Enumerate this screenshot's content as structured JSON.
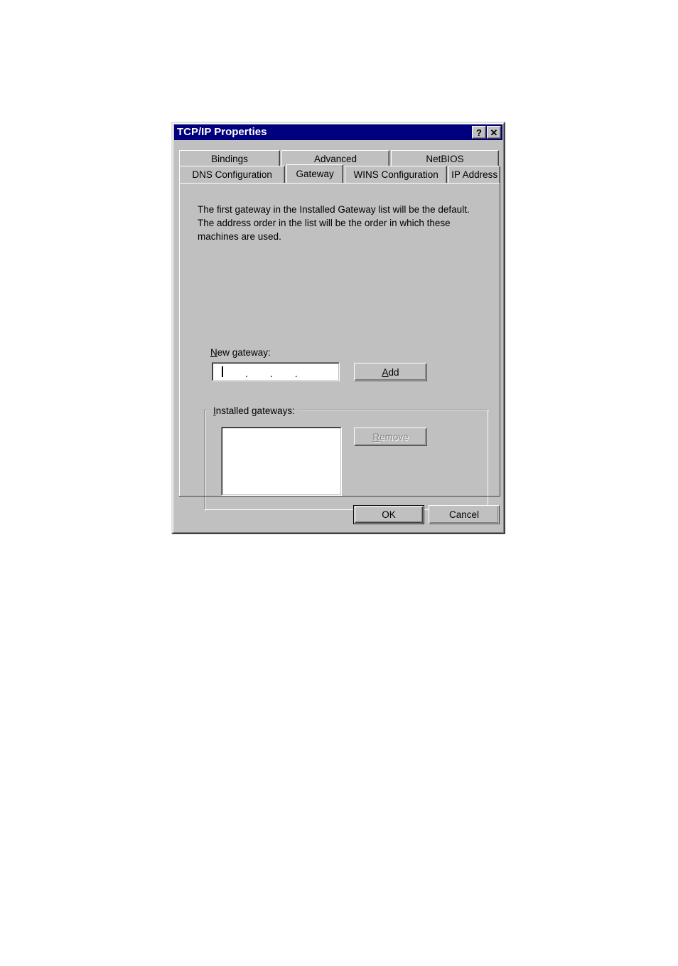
{
  "dialog": {
    "title": "TCP/IP Properties",
    "help_button": "?",
    "close_button": "✕"
  },
  "tabs": {
    "row1": [
      {
        "id": "bindings",
        "label": "Bindings",
        "selected": false
      },
      {
        "id": "advanced",
        "label": "Advanced",
        "selected": false
      },
      {
        "id": "netbios",
        "label": "NetBIOS",
        "selected": false
      }
    ],
    "row2": [
      {
        "id": "dns",
        "label": "DNS Configuration",
        "selected": false
      },
      {
        "id": "gateway",
        "label": "Gateway",
        "selected": true
      },
      {
        "id": "wins",
        "label": "WINS Configuration",
        "selected": false
      },
      {
        "id": "ipaddress",
        "label": "IP Address",
        "selected": false
      }
    ]
  },
  "page": {
    "description_line1": "The first gateway in the Installed Gateway list will be the default.",
    "description_line2": "The address order in the list will be the order in which these",
    "description_line3": "machines are used.",
    "new_gateway": {
      "label_accel": "N",
      "label_rest": "ew gateway:",
      "value": "",
      "placeholder": "   .   .   .   ",
      "separator": "."
    },
    "add_button": {
      "accel": "A",
      "rest": "dd",
      "enabled": true
    },
    "installed_gateways": {
      "label_accel": "I",
      "label_rest": "nstalled gateways:",
      "items": []
    },
    "remove_button": {
      "accel": "R",
      "rest": "emove",
      "enabled": false
    }
  },
  "footer": {
    "ok_label": "OK",
    "cancel_label": "Cancel"
  },
  "colors": {
    "face": "#c0c0c0",
    "titlebar": "#00007f",
    "titlebar_text": "#ffffff",
    "shadow": "#808080",
    "dark_shadow": "#404040",
    "highlight": "#ffffff",
    "window": "#ffffff",
    "text": "#000000",
    "disabled_text": "#808080"
  }
}
